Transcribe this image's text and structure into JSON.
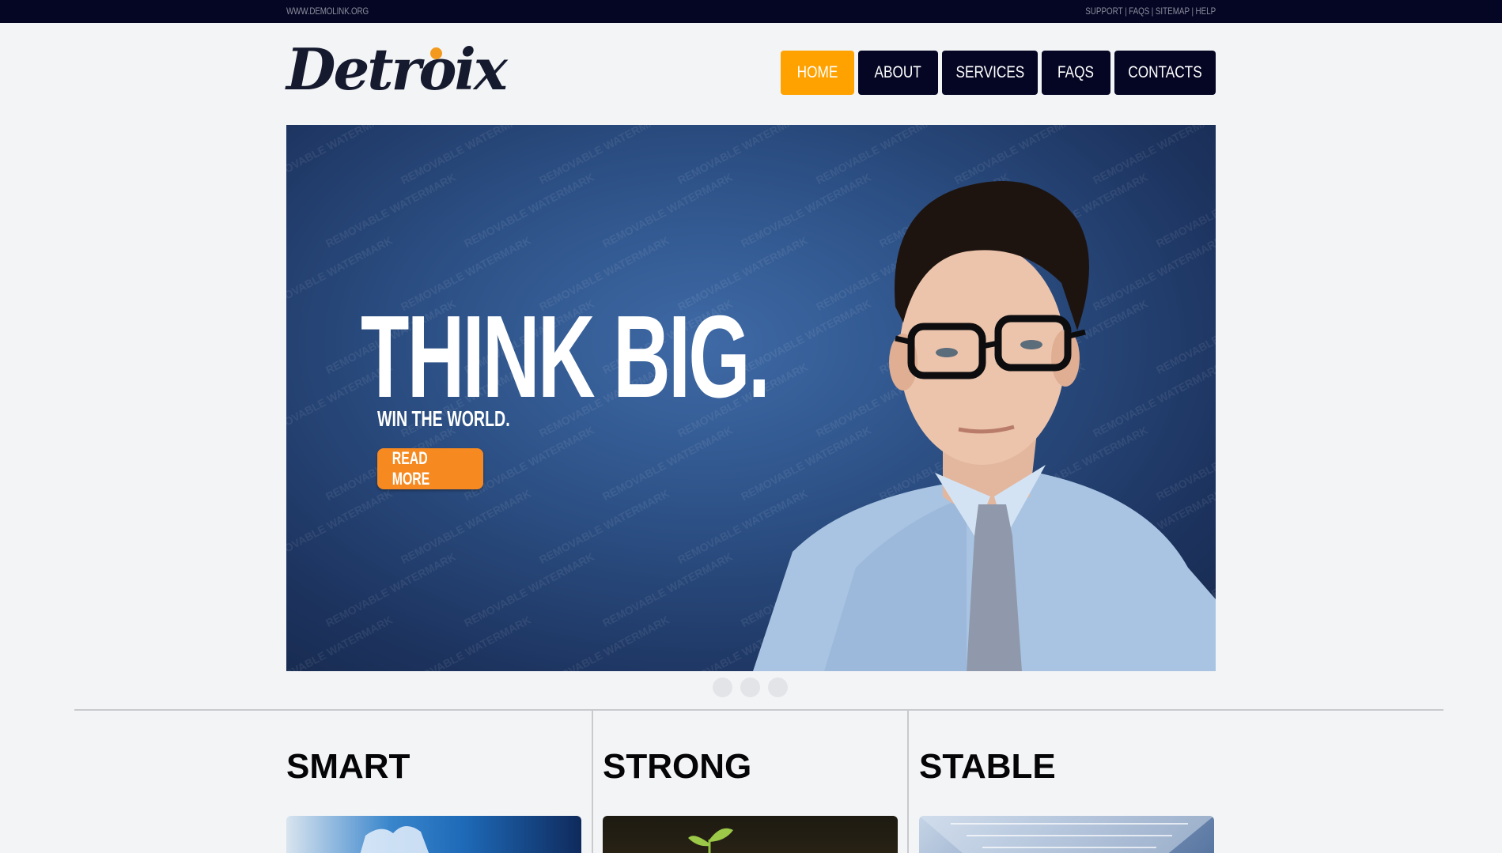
{
  "topbar": {
    "url": "WWW.DEMOLINK.ORG",
    "links": [
      "SUPPORT",
      "FAQS",
      "SITEMAP",
      "HELP"
    ],
    "separator": "|"
  },
  "logo": {
    "text": "Detroix"
  },
  "nav": {
    "items": [
      {
        "label": "HOME",
        "active": true
      },
      {
        "label": "ABOUT",
        "active": false
      },
      {
        "label": "SERVICES",
        "active": false
      },
      {
        "label": "FAQS",
        "active": false
      },
      {
        "label": "CONTACTS",
        "active": false
      }
    ]
  },
  "hero": {
    "headline": "THINK BIG.",
    "subheadline": "WIN THE WORLD.",
    "cta_label": "READ MORE",
    "watermark": "REMOVABLE WATERMARK"
  },
  "slider": {
    "dot_count": 3
  },
  "columns": [
    {
      "title": "SMART"
    },
    {
      "title": "STRONG"
    },
    {
      "title": "STABLE"
    }
  ],
  "colors": {
    "accent": "#ffa200",
    "navy": "#050624",
    "cta": "#f6891f",
    "background": "#f3f4f6"
  }
}
